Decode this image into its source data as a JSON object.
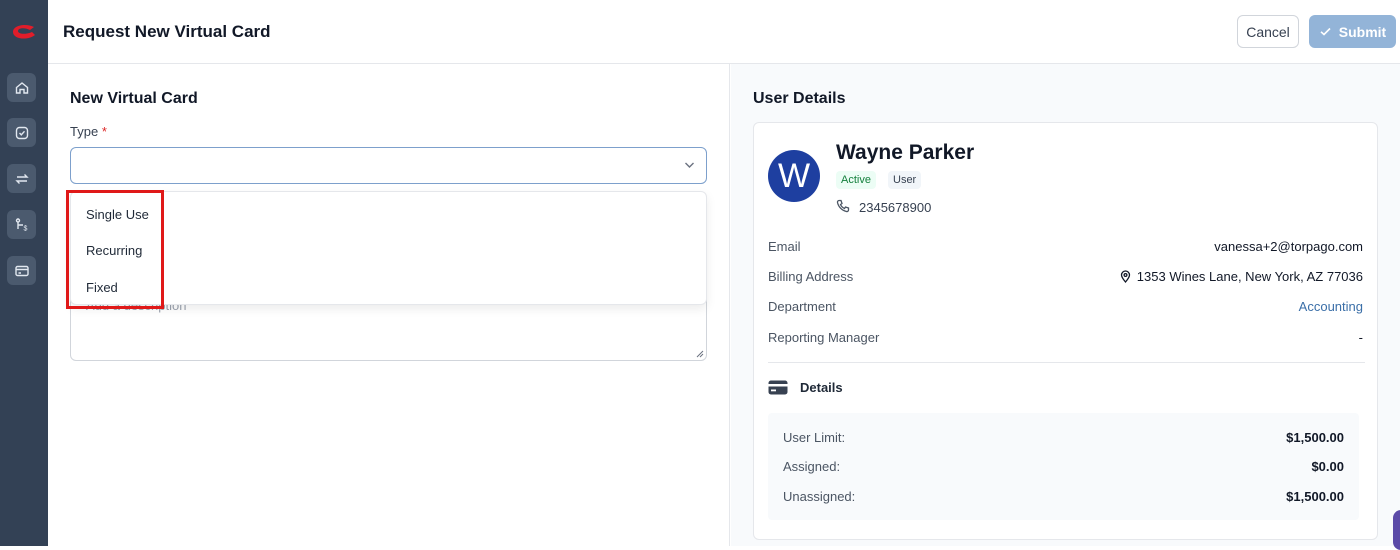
{
  "header": {
    "title": "Request New Virtual Card",
    "cancel_label": "Cancel",
    "submit_label": "Submit"
  },
  "sidebar": {
    "items": [
      {
        "icon": "home-icon"
      },
      {
        "icon": "check-circle-icon"
      },
      {
        "icon": "transfer-icon"
      },
      {
        "icon": "workflow-icon"
      },
      {
        "icon": "card-icon"
      }
    ]
  },
  "form": {
    "section_title": "New Virtual Card",
    "type_label": "Type",
    "required_mark": "*",
    "type_value": "",
    "type_options": [
      "Single Use",
      "Recurring",
      "Fixed"
    ],
    "description_placeholder": "Add a description"
  },
  "user": {
    "section_title": "User Details",
    "avatar_initial": "W",
    "name": "Wayne Parker",
    "status": "Active",
    "role": "User",
    "phone": "2345678900",
    "email_label": "Email",
    "email": "vanessa+2@torpago.com",
    "billing_label": "Billing Address",
    "billing_address": "1353 Wines Lane, New York, AZ 77036",
    "department_label": "Department",
    "department": "Accounting",
    "manager_label": "Reporting Manager",
    "manager": "-",
    "details_title": "Details",
    "limits": [
      {
        "label": "User Limit:",
        "value": "$1,500.00"
      },
      {
        "label": "Assigned:",
        "value": "$0.00"
      },
      {
        "label": "Unassigned:",
        "value": "$1,500.00"
      }
    ]
  },
  "colors": {
    "sidebar": "#334155",
    "submit_disabled": "#93b4d8",
    "avatar": "#1e3fa0",
    "highlight": "#e01818",
    "active_badge": "#15803d",
    "link": "#3b6fa8"
  }
}
